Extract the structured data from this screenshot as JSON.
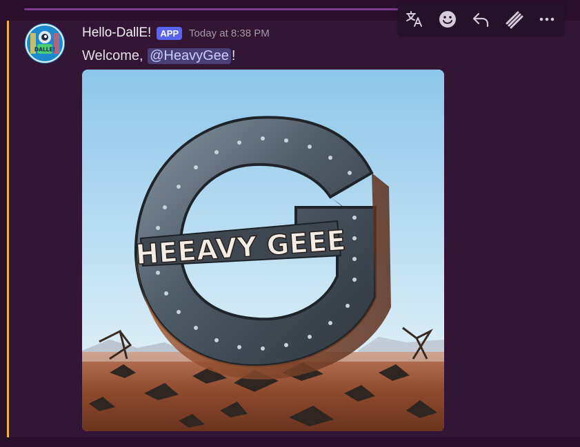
{
  "message": {
    "author": "Hello-DallE!",
    "badge": "APP",
    "timestamp": "Today at 8:38 PM",
    "content_prefix": "Welcome, ",
    "mention": "@HeavyGee",
    "content_suffix": "!"
  },
  "attachment": {
    "image_text": "HEEAVY GEEE"
  },
  "avatar": {
    "badge_text": "DALLE!"
  },
  "toolbar": {
    "items": [
      "translate-icon",
      "add-reaction-icon",
      "reply-icon",
      "app-command-icon",
      "more-icon"
    ]
  },
  "colors": {
    "accent_bar": "#f0b232",
    "app_badge": "#5865f2",
    "mention_bg": "#4b3f7a"
  }
}
